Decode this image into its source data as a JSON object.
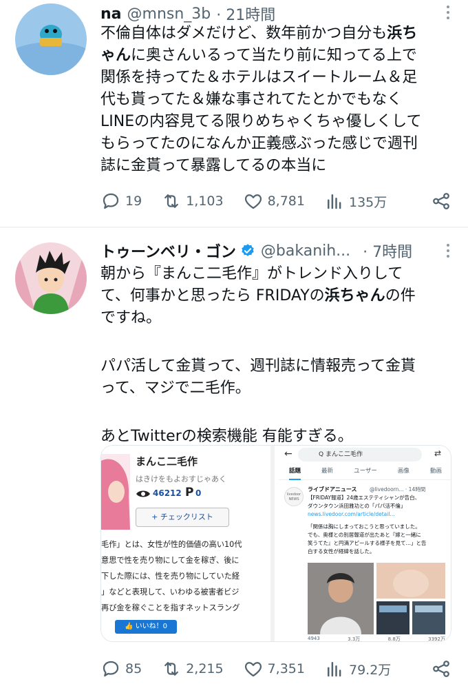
{
  "tweets": [
    {
      "name": "na",
      "handle": "@mnsn_3b",
      "time": "· 21時間",
      "body_lines": [
        [
          "不倫自体はダメだけど、数年前かつ自分も",
          "浜ち"
        ],
        [
          "ゃん",
          "に奥さんいるって当たり前に知ってる上で"
        ],
        [
          "関係を持ってた＆ホテルはスイートルーム＆足"
        ],
        [
          "代も貰ってた＆嫌な事されてたとかでもなく"
        ],
        [
          "LINEの内容見てる限りめちゃくちゃ優しくして"
        ],
        [
          "もらってたのになんか正義感ぶった感じで週刊"
        ],
        [
          "誌に金貰って暴露してるの本当に"
        ]
      ],
      "replies": "19",
      "retweets": "1,103",
      "likes": "8,781",
      "views": "135万"
    },
    {
      "name": "トゥーンベリ・ゴン",
      "handle": "@bakanih...",
      "time": "· 7時間",
      "body_p1": [
        "朝から『まんこ二毛作』がトレンド入りして",
        "て、何事かと思ったら FRIDAYの",
        "浜ちゃん",
        "の件",
        "ですね。"
      ],
      "body_p2": [
        "パパ活して金貰って、週刊誌に情報売って金貰",
        "って、マジで二毛作。"
      ],
      "body_p3": "あとTwitterの検索機能 有能すぎる。",
      "replies": "85",
      "retweets": "2,215",
      "likes": "7,351",
      "views": "79.2万"
    }
  ],
  "embed_left": {
    "title": "まんこ二毛作",
    "reading": "はきけをもよおすじゃあく",
    "views": "46212",
    "pcount": "0",
    "checklist": "+ チェックリスト",
    "lines": [
      "毛作」とは、女性が性的価値の高い10代",
      "意思で性を売り物にして金を稼ぎ、後に",
      "下した際には、性を売り物にしていた経",
      "」などと表現して、いわゆる被害者ビジ",
      "再び金を稼ぐことを指すネットスラング"
    ],
    "like_btn": "いいね！0"
  },
  "embed_right": {
    "search": "Q まんこ二毛作",
    "tabs": [
      "話題",
      "最新",
      "ユーザー",
      "画像",
      "動画"
    ],
    "account": "ライブドアニュース",
    "account_handle": "@livedoorn... · 14時間",
    "logo": "livedoor NEWS",
    "headline1": "【FRIDAY報道】24歳エステティシャンが告白、",
    "headline2": "ダウンタウン浜田雅功との「パパ活不倫」",
    "link": "news.livedoor.com/article/detail...",
    "quote1": "「関係は胸にしまっておこうと思っていました。",
    "quote2": "でも、奥様との別居報道が出たあと『嫁と一緒に",
    "quote3": "笑うてた』と円満アピールする様子を見て…」と告",
    "quote4": "白する女性が経緯を話した。",
    "stats": [
      "4943",
      "3.3万",
      "8.8万",
      "3392万"
    ]
  },
  "colors": {
    "link": "#1d9bf0",
    "muted": "#536471",
    "verified": "#1d9bf0"
  }
}
